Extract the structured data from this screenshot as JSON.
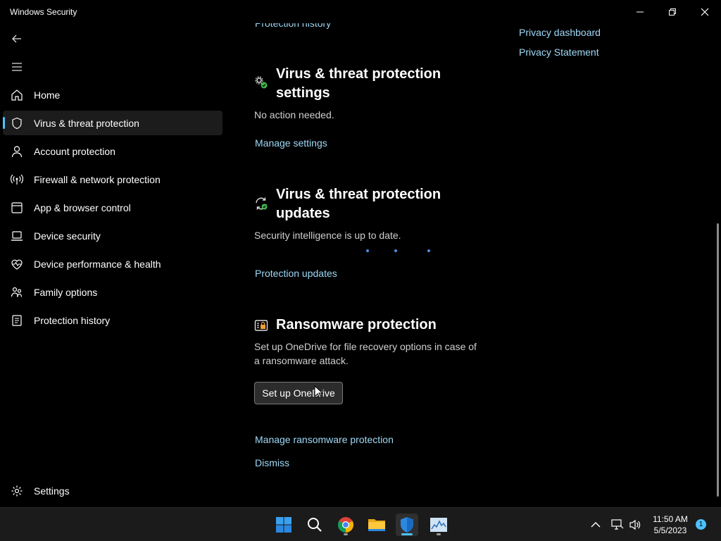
{
  "window": {
    "title": "Windows Security"
  },
  "sidebar": {
    "items": [
      {
        "label": "Home",
        "icon": "home-icon",
        "active": false
      },
      {
        "label": "Virus & threat protection",
        "icon": "shield-icon",
        "active": true
      },
      {
        "label": "Account protection",
        "icon": "person-icon",
        "active": false
      },
      {
        "label": "Firewall & network protection",
        "icon": "antenna-icon",
        "active": false
      },
      {
        "label": "App & browser control",
        "icon": "browser-window-icon",
        "active": false
      },
      {
        "label": "Device security",
        "icon": "laptop-icon",
        "active": false
      },
      {
        "label": "Device performance & health",
        "icon": "heart-pulse-icon",
        "active": false
      },
      {
        "label": "Family options",
        "icon": "family-icon",
        "active": false
      },
      {
        "label": "Protection history",
        "icon": "history-icon",
        "active": false
      }
    ],
    "settings_label": "Settings"
  },
  "main": {
    "top_link": "Protection history",
    "settings_section": {
      "title": "Virus & threat protection settings",
      "status": "No action needed.",
      "link": "Manage settings"
    },
    "updates_section": {
      "title": "Virus & threat protection updates",
      "status": "Security intelligence is up to date.",
      "link": "Protection updates"
    },
    "ransomware_section": {
      "title": "Ransomware protection",
      "description": "Set up OneDrive for file recovery options in case of a ransomware attack.",
      "button": "Set up OneDrive",
      "link_manage": "Manage ransomware protection",
      "link_dismiss": "Dismiss"
    },
    "right_links": [
      "Privacy dashboard",
      "Privacy Statement"
    ]
  },
  "taskbar": {
    "apps": [
      "start-icon",
      "search-icon",
      "chrome-icon",
      "file-explorer-icon",
      "windows-security-icon",
      "task-manager-icon"
    ],
    "clock_time": "11:50 AM",
    "clock_date": "5/5/2023",
    "notification_count": "1"
  },
  "colors": {
    "accent": "#4cc2ff",
    "link": "#9fd9f7",
    "status_ok": "#3fb950"
  }
}
